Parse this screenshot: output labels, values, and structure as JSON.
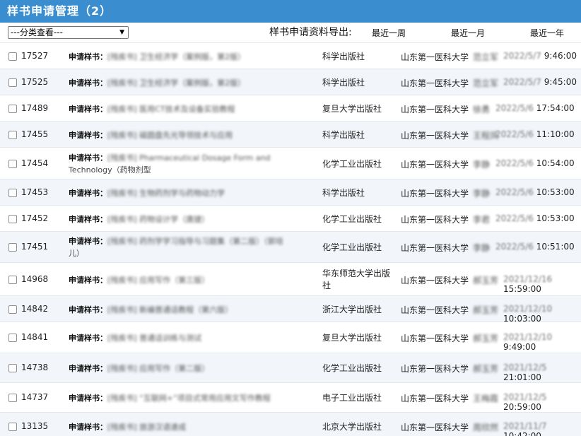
{
  "header": {
    "title": "样书申请管理（2）"
  },
  "toolbar": {
    "category_select": "---分类查看---",
    "export_label": "样书申请资料导出:",
    "export_links": [
      "最近一周",
      "最近一月",
      "最近一年"
    ]
  },
  "rows": [
    {
      "id": "17527",
      "label": "申请样书：",
      "book": "[残疾书] 卫生经济学（案例版，第2版）",
      "book_tail": "",
      "publisher": "科学出版社",
      "school": "山东第一医科大学",
      "person": "范立军",
      "date": "2022/5/7",
      "time": "9:46:00"
    },
    {
      "id": "17525",
      "label": "申请样书：",
      "book": "[残疾书] 卫生经济学（案例版，第2版）",
      "book_tail": "",
      "publisher": "科学出版社",
      "school": "山东第一医科大学",
      "person": "范立军",
      "date": "2022/5/7",
      "time": "9:45:00"
    },
    {
      "id": "17489",
      "label": "申请样书：",
      "book": "[残疾书] 医用CT技术及设备实验教程",
      "book_tail": "",
      "publisher": "复旦大学出版社",
      "school": "山东第一医科大学",
      "person": "徐勇",
      "date": "2022/5/6",
      "time": "17:54:00"
    },
    {
      "id": "17455",
      "label": "申请样书：",
      "book": "[残疾书] 磁圆盘先光导领技术与应用",
      "book_tail": "",
      "publisher": "科学出版社",
      "school": "山东第一医科大学",
      "person": "王程凤",
      "date": "2022/5/6",
      "time": "11:10:00"
    },
    {
      "id": "17454",
      "label": "申请样书：",
      "book": "[残疾书] Pharmaceutical Dosage Form and",
      "book_tail": "Technology（药物剂型",
      "publisher": "化学工业出版社",
      "school": "山东第一医科大学",
      "person": "李静",
      "date": "2022/5/6",
      "time": "10:54:00"
    },
    {
      "id": "17453",
      "label": "申请样书：",
      "book": "[残疾书] 生物药剂学与药物动力学",
      "book_tail": "",
      "publisher": "科学出版社",
      "school": "山东第一医科大学",
      "person": "李静",
      "date": "2022/5/6",
      "time": "10:53:00"
    },
    {
      "id": "17452",
      "label": "申请样书：",
      "book": "[残疾书] 药物设计学（唐捷）",
      "book_tail": "",
      "publisher": "化学工业出版社",
      "school": "山东第一医科大学",
      "person": "李君",
      "date": "2022/5/6",
      "time": "10:53:00"
    },
    {
      "id": "17451",
      "label": "申请样书：",
      "book": "[残疾书] 药剂学学习指导与习题集（第二版）（郭培",
      "book_tail": "儿）",
      "publisher": "化学工业出版社",
      "school": "山东第一医科大学",
      "person": "李静",
      "date": "2022/5/6",
      "time": "10:51:00"
    },
    {
      "id": "14968",
      "label": "申请样书：",
      "book": "[残疾书] 应用写作（第三版）",
      "book_tail": "",
      "publisher": "华东师范大学出版社",
      "school": "山东第一医科大学",
      "person": "郝玉芳",
      "date": "2021/12/16",
      "time": "15:59:00"
    },
    {
      "id": "14842",
      "label": "申请样书：",
      "book": "[残疾书] 新编普通话教程（第六版）",
      "book_tail": "",
      "publisher": "浙江大学出版社",
      "school": "山东第一医科大学",
      "person": "郝玉芳",
      "date": "2021/12/10",
      "time": "10:03:00"
    },
    {
      "id": "14841",
      "label": "申请样书：",
      "book": "[残疾书] 普通话训练与测试",
      "book_tail": "",
      "publisher": "复旦大学出版社",
      "school": "山东第一医科大学",
      "person": "郝玉芳",
      "date": "2021/12/10",
      "time": "9:49:00"
    },
    {
      "id": "14738",
      "label": "申请样书：",
      "book": "[残疾书] 应用写作（第二版）",
      "book_tail": "",
      "publisher": "化学工业出版社",
      "school": "山东第一医科大学",
      "person": "郝玉芳",
      "date": "2021/12/5",
      "time": "21:01:00"
    },
    {
      "id": "14737",
      "label": "申请样书：",
      "book": "[残疾书] “互联网+”项目式常用应用文写作教程",
      "book_tail": "",
      "publisher": "电子工业出版社",
      "school": "山东第一医科大学",
      "person": "王梅霞",
      "date": "2021/12/5",
      "time": "20:59:00"
    },
    {
      "id": "13135",
      "label": "申请样书：",
      "book": "[残疾书] 旅游汉语速成",
      "book_tail": "",
      "publisher": "北京大学出版社",
      "school": "山东第一医科大学",
      "person": "周欣然",
      "date": "2021/11/7",
      "time": "10:42:00"
    }
  ],
  "colors": {
    "header_bg": "#3a8ed0",
    "row_alt_bg": "#f2f6fa"
  },
  "icons": {
    "select_arrow": "chevron-down-icon",
    "row_checkbox": "checkbox-icon"
  }
}
